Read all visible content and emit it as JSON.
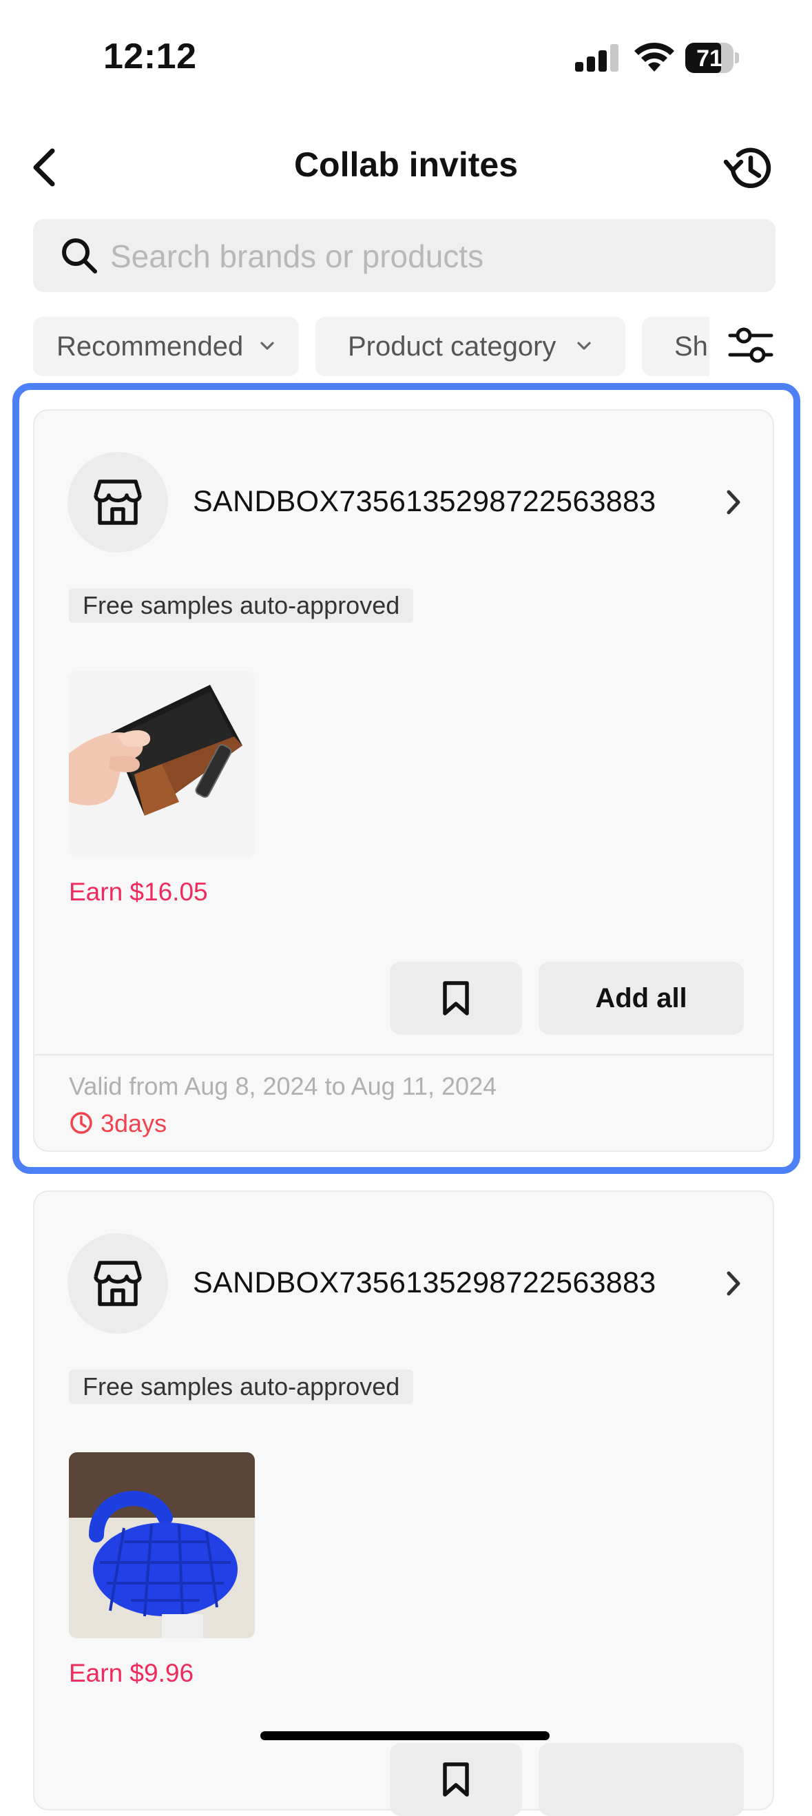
{
  "status_bar": {
    "time": "12:12",
    "battery": "71",
    "icons": [
      "signal-icon",
      "wifi-icon",
      "battery-icon"
    ]
  },
  "nav": {
    "title": "Collab invites",
    "back_icon": "back-chevron-icon",
    "history_icon": "history-icon"
  },
  "search": {
    "placeholder": "Search brands or products",
    "value": ""
  },
  "filters": {
    "chips": [
      "Recommended",
      "Product category",
      "Sh"
    ],
    "filter_icon": "sliders-icon"
  },
  "colors": {
    "accent_highlight": "#4d7ff5",
    "earn": "#ef2a5c",
    "countdown": "#f0434e"
  },
  "invites": [
    {
      "shop_name": "SANDBOX7356135298722563883",
      "tag": "Free samples auto-approved",
      "product_image": "black-leather-wallet",
      "earn": "Earn $16.05",
      "add_all_label": "Add all",
      "valid_text": "Valid from Aug 8, 2024 to Aug 11, 2024",
      "countdown": "3days"
    },
    {
      "shop_name": "SANDBOX7356135298722563883",
      "tag": "Free samples auto-approved",
      "product_image": "blue-quilted-bag",
      "earn": "Earn $9.96"
    }
  ]
}
